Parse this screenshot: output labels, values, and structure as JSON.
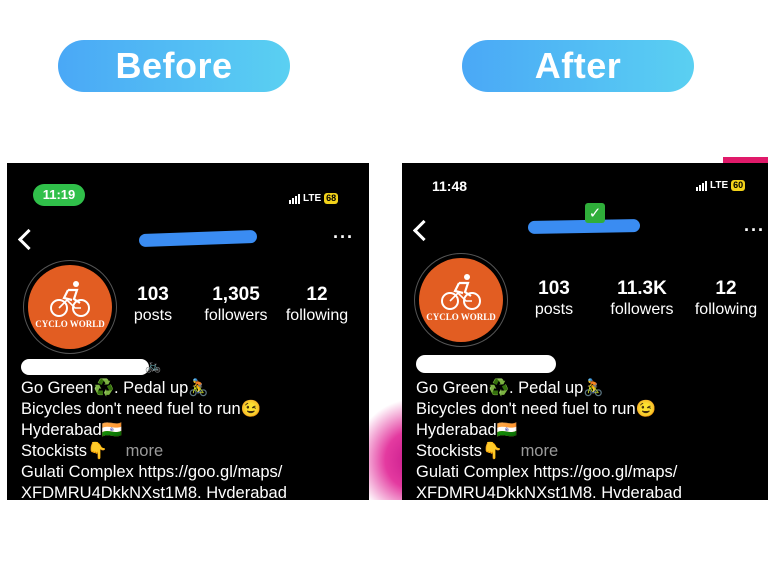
{
  "labels": {
    "before": "Before",
    "after": "After"
  },
  "before": {
    "time": "11:19",
    "network": "LTE",
    "battery": "68",
    "stats": [
      {
        "value": "103",
        "label": "posts"
      },
      {
        "value": "1,305",
        "label": "followers"
      },
      {
        "value": "12",
        "label": "following"
      }
    ]
  },
  "after": {
    "time": "11:48",
    "network": "LTE",
    "battery": "60",
    "verified_badge": "✓",
    "stats": [
      {
        "value": "103",
        "label": "posts"
      },
      {
        "value": "11.3K",
        "label": "followers"
      },
      {
        "value": "12",
        "label": "following"
      }
    ]
  },
  "profile": {
    "logo_text": "CYCLO WORLD",
    "bio": {
      "line1": "Go Green♻️. Pedal up🚴",
      "line2": "Bicycles don't need fuel to run😉",
      "line3": "Hyderabad🇮🇳",
      "line4": "Stockists👇",
      "more": "more",
      "line5": "Gulati Complex https://goo.gl/maps/",
      "line6": "XFDMRU4DkkNXst1M8. Hvderabad"
    },
    "icons": {
      "back": "chevron-left-icon",
      "options": "more-options-icon",
      "bicycle": "bicycle-icon"
    }
  },
  "colors": {
    "pill_start": "#4aa8f6",
    "pill_end": "#5ad0f2",
    "status_time_pill": "#30c04a",
    "battery": "#f2d21a",
    "avatar": "#e25d22",
    "redaction": "#3a8cf2",
    "more_text": "#9a9a9a"
  }
}
